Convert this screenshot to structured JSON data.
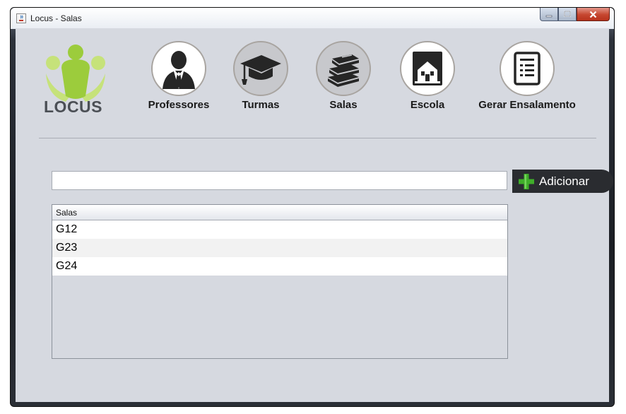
{
  "window": {
    "title": "Locus - Salas"
  },
  "logo": {
    "text": "LOCUS"
  },
  "nav": [
    {
      "label": "Professores",
      "icon": "person-icon"
    },
    {
      "label": "Turmas",
      "icon": "graduation-cap-icon"
    },
    {
      "label": "Salas",
      "icon": "books-icon"
    },
    {
      "label": "Escola",
      "icon": "school-building-icon"
    },
    {
      "label": "Gerar Ensalamento",
      "icon": "document-icon"
    }
  ],
  "search": {
    "value": "",
    "placeholder": ""
  },
  "add_button": {
    "label": "Adicionar"
  },
  "table": {
    "header": "Salas",
    "rows": [
      "G12",
      "G23",
      "G24"
    ]
  },
  "colors": {
    "content_bg": "#d6d9e0",
    "button_bg": "#2a2c30",
    "plus_green": "#3fae2a",
    "logo_green": "#9ccc3c"
  }
}
